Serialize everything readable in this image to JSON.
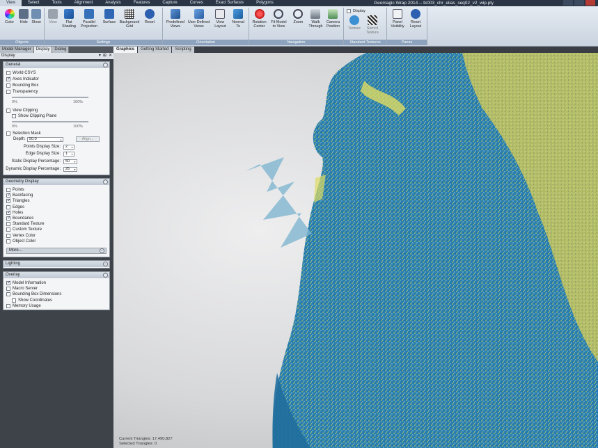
{
  "window": {
    "title": "Geomagic Wrap 2014 -- tk003_chr_elias_seq02_v2_wip.ply"
  },
  "ribbon_tabs": [
    "View",
    "Select",
    "Tools",
    "Alignment",
    "Analysis",
    "Features",
    "Capture",
    "Curves",
    "Exact Surfaces",
    "Polygons"
  ],
  "ribbon": {
    "objects": {
      "label": "Objects",
      "buttons": [
        "Color",
        "Hide",
        "Show"
      ]
    },
    "settings": {
      "label": "Settings",
      "buttons": [
        "View",
        "Flat\nShading",
        "Parallel\nProjection",
        "Surface",
        "Background\nGrid",
        "Reset"
      ]
    },
    "orientation": {
      "label": "Orientation",
      "buttons": [
        "Predefined\nViews",
        "User Defined\nViews",
        "View\nLayout",
        "Normal\nTo"
      ]
    },
    "navigation": {
      "label": "Navigation",
      "buttons": [
        "Rotation\nCenter",
        "Fit Model\nto View",
        "Zoom",
        "Walk\nThrough",
        "Camera\nPosition"
      ]
    },
    "standard_textures": {
      "label": "Standard Textures",
      "display": "Display",
      "buttons": [
        "Texture",
        "Stencil\nTexture"
      ]
    },
    "panes": {
      "label": "Panes",
      "buttons": [
        "Panel\nVisibility",
        "Reset\nLayout"
      ]
    }
  },
  "dock": {
    "tabs": [
      "Model Manager",
      "Display",
      "Dialog"
    ],
    "header": "Display",
    "pin_icons": [
      "▾",
      "⊞",
      "✕"
    ]
  },
  "general_panel": {
    "title": "General",
    "world_csys": "World CSYS",
    "axes_indicator": "Axes Indicator",
    "bounding_box": "Bounding Box",
    "transparency": "Transparency",
    "slider_min": "0%",
    "slider_max": "100%",
    "view_clipping": "View Clipping",
    "show_clipping_plane": "Show Clipping Plane",
    "slider2_min": "0%",
    "slider2_max": "100%",
    "selection_mask": "Selection Mask",
    "depth_label": "Depth:",
    "depth_value": "50.0",
    "align_button": "Align...",
    "points_display_size_label": "Points Display Size:",
    "points_display_size": "2",
    "edge_display_size_label": "Edge Display Size:",
    "edge_display_size": "1",
    "static_display_pct_label": "Static Display Percentage:",
    "static_display_pct": "50",
    "dynamic_display_pct_label": "Dynamic Display Percentage:",
    "dynamic_display_pct": "25"
  },
  "geometry_panel": {
    "title": "Geometry Display",
    "items": [
      {
        "label": "Points",
        "checked": false
      },
      {
        "label": "Backfacing",
        "checked": true
      },
      {
        "label": "Triangles",
        "checked": true
      },
      {
        "label": "Edges",
        "checked": false
      },
      {
        "label": "Holes",
        "checked": true
      },
      {
        "label": "Boundaries",
        "checked": true
      },
      {
        "label": "Standard Texture",
        "checked": false
      },
      {
        "label": "Custom Texture",
        "checked": false
      },
      {
        "label": "Vertex Color",
        "checked": false
      },
      {
        "label": "Object Color",
        "checked": false
      }
    ],
    "more": "More..."
  },
  "lighting_panel": {
    "title": "Lighting"
  },
  "overlay_panel": {
    "title": "Overlay",
    "items": [
      {
        "label": "Model Information",
        "checked": true
      },
      {
        "label": "Macro Server",
        "checked": false
      },
      {
        "label": "Bounding Box Dimensions",
        "checked": false
      },
      {
        "label": "Show Coordinates",
        "checked": false
      },
      {
        "label": "Memory Usage",
        "checked": false
      }
    ]
  },
  "viewport": {
    "tabs": [
      "Graphics",
      "Getting Started",
      "Scripting"
    ],
    "current_triangles": "Current Triangles: 17,490,827",
    "selected_triangles": "Selected Triangles: 0"
  },
  "colors": {
    "mesh_blue": "#2d86b6",
    "mesh_yellow": "#d8d957",
    "ribbon_bar": "#2a3546"
  }
}
